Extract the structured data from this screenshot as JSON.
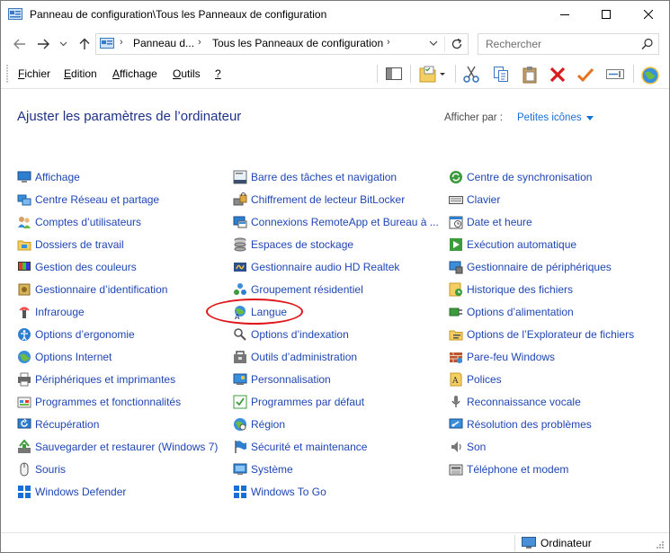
{
  "window": {
    "title": "Panneau de configuration\\Tous les Panneaux de configuration"
  },
  "address": {
    "crumbs": [
      "Panneau d...",
      "Tous les Panneaux de configuration"
    ],
    "search_placeholder": "Rechercher"
  },
  "menu": {
    "items": [
      {
        "label": "Fichier",
        "underline": "F",
        "rest": "ichier"
      },
      {
        "label": "Edition",
        "underline": "E",
        "rest": "dition"
      },
      {
        "label": "Affichage",
        "underline": "A",
        "rest": "ffichage"
      },
      {
        "label": "Outils",
        "underline": "O",
        "rest": "utils"
      },
      {
        "label": "?",
        "underline": "?",
        "rest": ""
      }
    ]
  },
  "content": {
    "heading": "Ajuster les paramètres de l’ordinateur",
    "view_by_label": "Afficher par :",
    "view_by_value": "Petites icônes"
  },
  "columns": [
    [
      {
        "label": "Affichage",
        "icon": "display-icon"
      },
      {
        "label": "Centre Réseau et partage",
        "icon": "network-icon"
      },
      {
        "label": "Comptes d’utilisateurs",
        "icon": "users-icon"
      },
      {
        "label": "Dossiers de travail",
        "icon": "work-folders-icon"
      },
      {
        "label": "Gestion des couleurs",
        "icon": "color-management-icon"
      },
      {
        "label": "Gestionnaire d’identification",
        "icon": "credential-icon"
      },
      {
        "label": "Infrarouge",
        "icon": "infrared-icon"
      },
      {
        "label": "Options d’ergonomie",
        "icon": "ease-of-access-icon"
      },
      {
        "label": "Options Internet",
        "icon": "internet-options-icon"
      },
      {
        "label": "Périphériques et imprimantes",
        "icon": "printer-icon"
      },
      {
        "label": "Programmes et fonctionnalités",
        "icon": "programs-icon"
      },
      {
        "label": "Récupération",
        "icon": "recovery-icon"
      },
      {
        "label": "Sauvegarder et restaurer (Windows 7)",
        "icon": "backup-icon"
      },
      {
        "label": "Souris",
        "icon": "mouse-icon"
      },
      {
        "label": "Windows Defender",
        "icon": "defender-icon"
      }
    ],
    [
      {
        "label": "Barre des tâches et navigation",
        "icon": "taskbar-icon"
      },
      {
        "label": "Chiffrement de lecteur BitLocker",
        "icon": "bitlocker-icon"
      },
      {
        "label": "Connexions RemoteApp et Bureau à ...",
        "icon": "remoteapp-icon"
      },
      {
        "label": "Espaces de stockage",
        "icon": "storage-spaces-icon"
      },
      {
        "label": "Gestionnaire audio HD Realtek",
        "icon": "realtek-audio-icon"
      },
      {
        "label": "Groupement résidentiel",
        "icon": "homegroup-icon"
      },
      {
        "label": "Langue",
        "icon": "language-icon"
      },
      {
        "label": "Options d’indexation",
        "icon": "indexing-icon"
      },
      {
        "label": "Outils d’administration",
        "icon": "admin-tools-icon"
      },
      {
        "label": "Personnalisation",
        "icon": "personalization-icon"
      },
      {
        "label": "Programmes par défaut",
        "icon": "default-programs-icon"
      },
      {
        "label": "Région",
        "icon": "region-icon"
      },
      {
        "label": "Sécurité et maintenance",
        "icon": "security-flag-icon"
      },
      {
        "label": "Système",
        "icon": "system-icon"
      },
      {
        "label": "Windows To Go",
        "icon": "windows-to-go-icon"
      }
    ],
    [
      {
        "label": "Centre de synchronisation",
        "icon": "sync-icon"
      },
      {
        "label": "Clavier",
        "icon": "keyboard-icon"
      },
      {
        "label": "Date et heure",
        "icon": "date-time-icon"
      },
      {
        "label": "Exécution automatique",
        "icon": "autoplay-icon"
      },
      {
        "label": "Gestionnaire de périphériques",
        "icon": "device-manager-icon"
      },
      {
        "label": "Historique des fichiers",
        "icon": "file-history-icon"
      },
      {
        "label": "Options d’alimentation",
        "icon": "power-icon"
      },
      {
        "label": "Options de l’Explorateur de fichiers",
        "icon": "explorer-options-icon"
      },
      {
        "label": "Pare-feu Windows",
        "icon": "firewall-icon"
      },
      {
        "label": "Polices",
        "icon": "fonts-icon"
      },
      {
        "label": "Reconnaissance vocale",
        "icon": "speech-icon"
      },
      {
        "label": "Résolution des problèmes",
        "icon": "troubleshoot-icon"
      },
      {
        "label": "Son",
        "icon": "sound-icon"
      },
      {
        "label": "Téléphone et modem",
        "icon": "phone-modem-icon"
      }
    ]
  ],
  "status": {
    "location": "Ordinateur"
  },
  "colors": {
    "heading": "#1e3287",
    "link": "#1f46b4",
    "accent": "#1a6fd6",
    "highlight": "#e0161b"
  }
}
